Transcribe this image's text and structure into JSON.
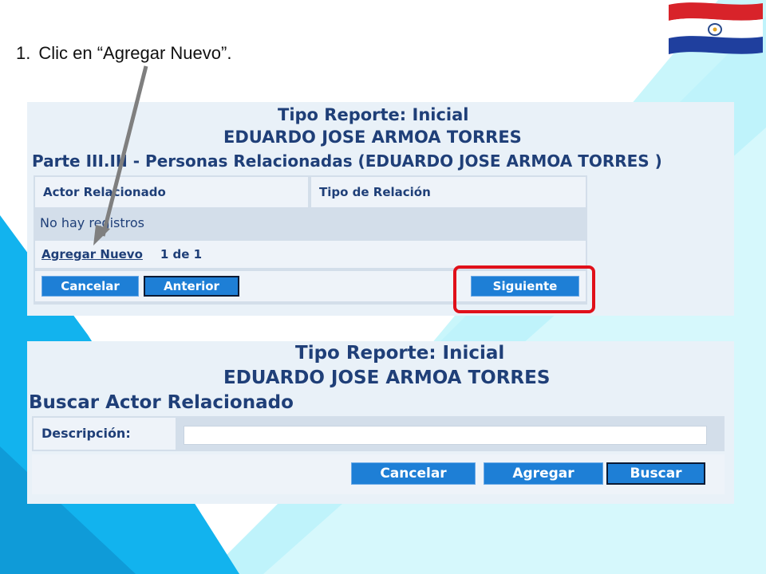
{
  "instruction": {
    "number": "1.",
    "text": "Clic en “Agregar Nuevo”."
  },
  "colors": {
    "accent_blue": "#1e7fd6",
    "highlight_red": "#e0101a",
    "bg_cyan": "#bff3fb",
    "bg_blue": "#12b3ee"
  },
  "icons": {
    "flag": "paraguay-flag-icon",
    "arrow": "pointer-arrow-icon"
  },
  "panel_a": {
    "title1": "Tipo Reporte: Inicial",
    "title2": "EDUARDO JOSE ARMOA TORRES",
    "section_title": "Parte III.III - Personas Relacionadas (EDUARDO JOSE ARMOA TORRES )",
    "columns": [
      "Actor Relacionado",
      "Tipo de Relación"
    ],
    "empty_text": "No hay registros",
    "add_link": "Agregar Nuevo",
    "pager": "1 de 1",
    "buttons": {
      "cancel": "Cancelar",
      "previous": "Anterior",
      "next": "Siguiente"
    }
  },
  "panel_b": {
    "title1": "Tipo Reporte: Inicial",
    "title2": "EDUARDO JOSE ARMOA TORRES",
    "section_title": "Buscar Actor Relacionado",
    "field_label": "Descripción:",
    "field_value": "",
    "buttons": {
      "cancel": "Cancelar",
      "add": "Agregar",
      "search": "Buscar"
    }
  }
}
